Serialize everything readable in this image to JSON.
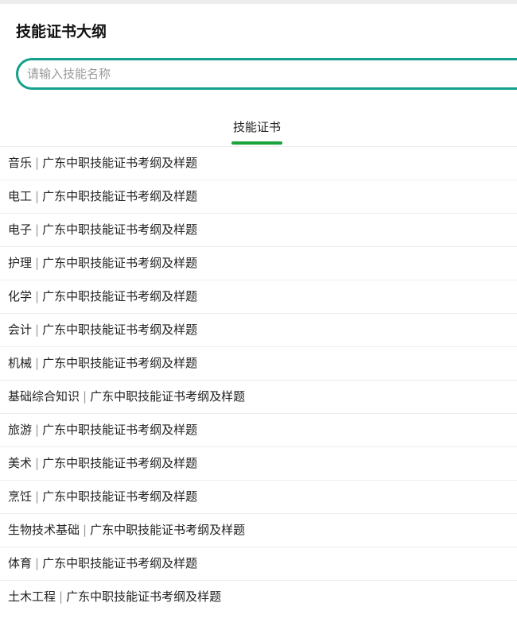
{
  "page": {
    "title": "技能证书大纲"
  },
  "search": {
    "placeholder": "请输入技能名称",
    "value": ""
  },
  "tabs": [
    {
      "label": "技能证书",
      "active": true
    }
  ],
  "colors": {
    "search_border": "#14a08c",
    "tab_indicator": "#1aa33a"
  },
  "list": {
    "separator": "|",
    "suffix": "广东中职技能证书考纲及样题",
    "items": [
      {
        "name": "音乐"
      },
      {
        "name": "电工"
      },
      {
        "name": "电子"
      },
      {
        "name": "护理"
      },
      {
        "name": "化学"
      },
      {
        "name": "会计"
      },
      {
        "name": "机械"
      },
      {
        "name": "基础综合知识"
      },
      {
        "name": "旅游"
      },
      {
        "name": "美术"
      },
      {
        "name": "烹饪"
      },
      {
        "name": "生物技术基础"
      },
      {
        "name": "体育"
      },
      {
        "name": "土木工程"
      }
    ]
  }
}
